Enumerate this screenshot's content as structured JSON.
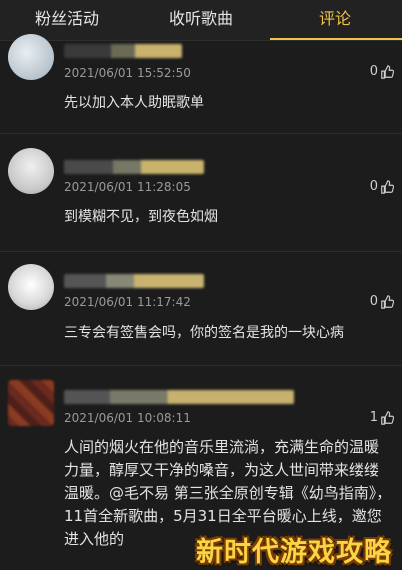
{
  "tabs": [
    {
      "label": "粉丝活动"
    },
    {
      "label": "收听歌曲"
    },
    {
      "label": "评论"
    }
  ],
  "comments": [
    {
      "time": "2021/06/01 15:52:50",
      "likes": "0",
      "text": "先以加入本人助眠歌单"
    },
    {
      "time": "2021/06/01 11:28:05",
      "likes": "0",
      "text": "到模糊不见，到夜色如烟"
    },
    {
      "time": "2021/06/01 11:17:42",
      "likes": "0",
      "text": "三专会有签售会吗，你的签名是我的一块心病"
    },
    {
      "time": "2021/06/01 10:08:11",
      "likes": "1",
      "text": "人间的烟火在他的音乐里流淌，充满生命的温暖力量，醇厚又干净的嗓音，为这人世间带来缕缕温暖。@毛不易 第三张全原创专辑《幼鸟指南》，11首全新歌曲，5月31日全平台暖心上线，邀您进入他的"
    }
  ],
  "watermark": "新时代游戏攻略",
  "colors": {
    "accent": "#f0c24d",
    "background": "#1c1c1c"
  }
}
